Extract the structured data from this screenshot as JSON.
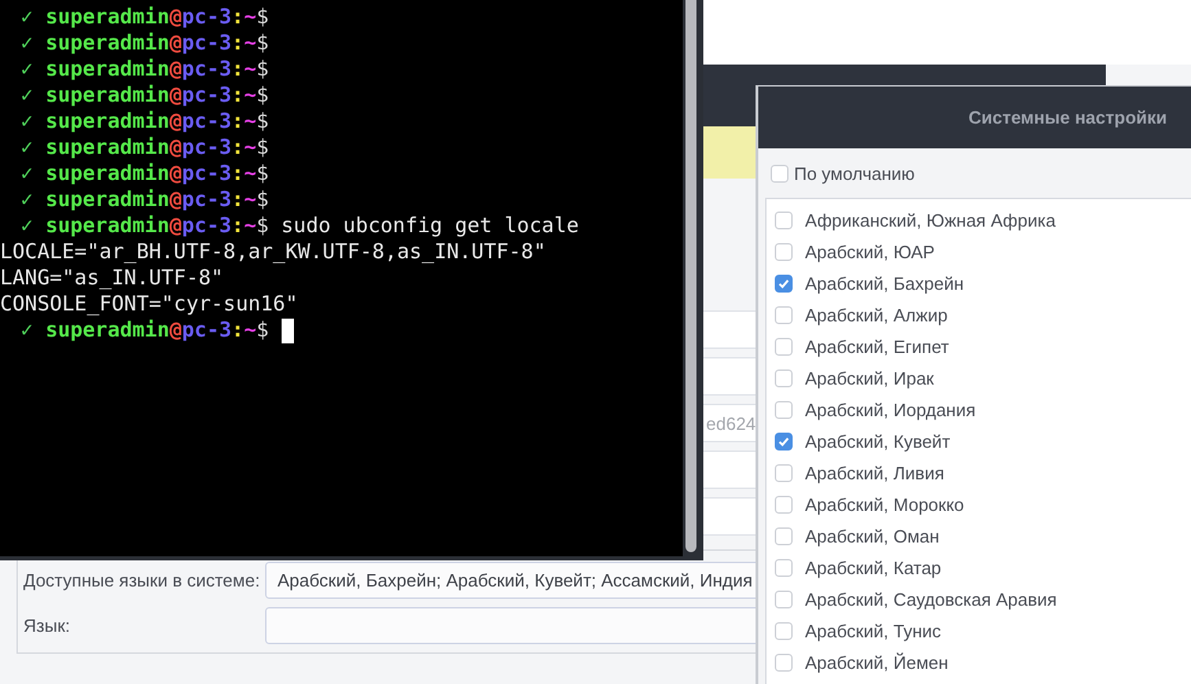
{
  "background_window": {
    "field_rows": [
      {
        "kind": "field"
      },
      {
        "kind": "field"
      },
      {
        "kind": "field",
        "value": "ed624"
      },
      {
        "kind": "field"
      },
      {
        "kind": "field"
      }
    ],
    "locale_group": {
      "rows": [
        {
          "label": "Доступные языки в системе:",
          "value": "Арабский, Бахрейн; Арабский, Кувейт; Ассамский, Индия"
        },
        {
          "label": "Язык:"
        }
      ]
    }
  },
  "terminal": {
    "lines": [
      {
        "kind": "prompt",
        "status": "✓",
        "user": "superadmin",
        "at": "@",
        "host": "pc-3",
        "colon": ":",
        "path": "~",
        "sign": "$"
      },
      {
        "kind": "prompt",
        "status": "✓",
        "user": "superadmin",
        "at": "@",
        "host": "pc-3",
        "colon": ":",
        "path": "~",
        "sign": "$"
      },
      {
        "kind": "prompt",
        "status": "✓",
        "user": "superadmin",
        "at": "@",
        "host": "pc-3",
        "colon": ":",
        "path": "~",
        "sign": "$"
      },
      {
        "kind": "prompt",
        "status": "✓",
        "user": "superadmin",
        "at": "@",
        "host": "pc-3",
        "colon": ":",
        "path": "~",
        "sign": "$"
      },
      {
        "kind": "prompt",
        "status": "✓",
        "user": "superadmin",
        "at": "@",
        "host": "pc-3",
        "colon": ":",
        "path": "~",
        "sign": "$"
      },
      {
        "kind": "prompt",
        "status": "✓",
        "user": "superadmin",
        "at": "@",
        "host": "pc-3",
        "colon": ":",
        "path": "~",
        "sign": "$"
      },
      {
        "kind": "prompt",
        "status": "✓",
        "user": "superadmin",
        "at": "@",
        "host": "pc-3",
        "colon": ":",
        "path": "~",
        "sign": "$"
      },
      {
        "kind": "prompt",
        "status": "✓",
        "user": "superadmin",
        "at": "@",
        "host": "pc-3",
        "colon": ":",
        "path": "~",
        "sign": "$"
      },
      {
        "kind": "prompt",
        "status": "✓",
        "user": "superadmin",
        "at": "@",
        "host": "pc-3",
        "colon": ":",
        "path": "~",
        "sign": "$",
        "command": "sudo ubconfig get locale"
      },
      {
        "kind": "output",
        "text": "LOCALE=\"ar_BH.UTF-8,ar_KW.UTF-8,as_IN.UTF-8\""
      },
      {
        "kind": "output",
        "text": "LANG=\"as_IN.UTF-8\""
      },
      {
        "kind": "output",
        "text": "CONSOLE_FONT=\"cyr-sun16\""
      },
      {
        "kind": "prompt",
        "status": "✓",
        "user": "superadmin",
        "at": "@",
        "host": "pc-3",
        "colon": ":",
        "path": "~",
        "sign": "$",
        "cursor": true
      }
    ]
  },
  "dialog": {
    "title": "Системные настройки",
    "default_option": {
      "label": "По умолчанию",
      "checked": false
    },
    "languages": [
      {
        "label": "Африканский, Южная Африка",
        "checked": false
      },
      {
        "label": "Арабский, ЮАР",
        "checked": false
      },
      {
        "label": "Арабский, Бахрейн",
        "checked": true
      },
      {
        "label": "Арабский, Алжир",
        "checked": false
      },
      {
        "label": "Арабский, Египет",
        "checked": false
      },
      {
        "label": "Арабский, Ирак",
        "checked": false
      },
      {
        "label": "Арабский, Иордания",
        "checked": false
      },
      {
        "label": "Арабский, Кувейт",
        "checked": true
      },
      {
        "label": "Арабский, Ливия",
        "checked": false
      },
      {
        "label": "Арабский, Морокко",
        "checked": false
      },
      {
        "label": "Арабский, Оман",
        "checked": false
      },
      {
        "label": "Арабский, Катар",
        "checked": false
      },
      {
        "label": "Арабский, Саудовская Аравия",
        "checked": false
      },
      {
        "label": "Арабский, Тунис",
        "checked": false
      },
      {
        "label": "Арабский, Йемен",
        "checked": false
      }
    ]
  }
}
